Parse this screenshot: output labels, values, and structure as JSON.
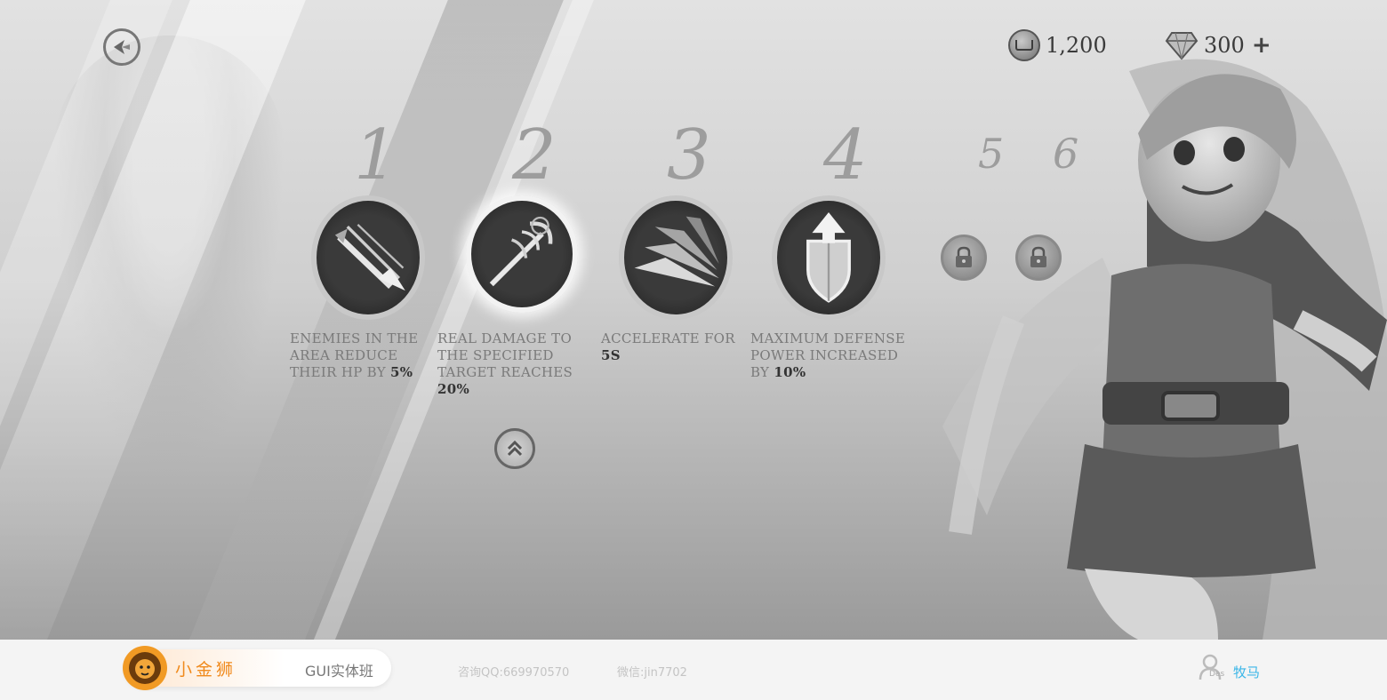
{
  "currency": {
    "coins": "1,200",
    "gems": "300",
    "gems_add": "+"
  },
  "slots": [
    {
      "number": "1",
      "state": "unlocked",
      "icon": "arrow-burst-icon",
      "desc_text": "ENEMIES IN THE\nAREA REDUCE\nTHEIR HP BY ",
      "desc_value": "5%"
    },
    {
      "number": "2",
      "state": "selected",
      "icon": "trident-icon",
      "desc_text": "REAL DAMAGE TO\nTHE SPECIFIED\nTARGET REACHES\n",
      "desc_value": "20%"
    },
    {
      "number": "3",
      "state": "unlocked",
      "icon": "speed-streak-icon",
      "desc_text": "ACCELERATE FOR\n",
      "desc_value": "5S"
    },
    {
      "number": "4",
      "state": "unlocked",
      "icon": "shield-up-icon",
      "desc_text": "MAXIMUM DEFENSE\nPOWER INCREASED\nBY ",
      "desc_value": "10%"
    },
    {
      "number": "5",
      "state": "locked",
      "icon": "lock-icon"
    },
    {
      "number": "6",
      "state": "locked",
      "icon": "lock-icon"
    }
  ],
  "footer": {
    "brand": "小金狮",
    "course": "GUI实体班",
    "qq": "咨询QQ:669970570",
    "wechat": "微信:jin7702",
    "user_sub": "Des",
    "user_name": "牧马"
  },
  "colors": {
    "brand_orange": "#f08a1c",
    "user_blue": "#3ab6e8"
  }
}
